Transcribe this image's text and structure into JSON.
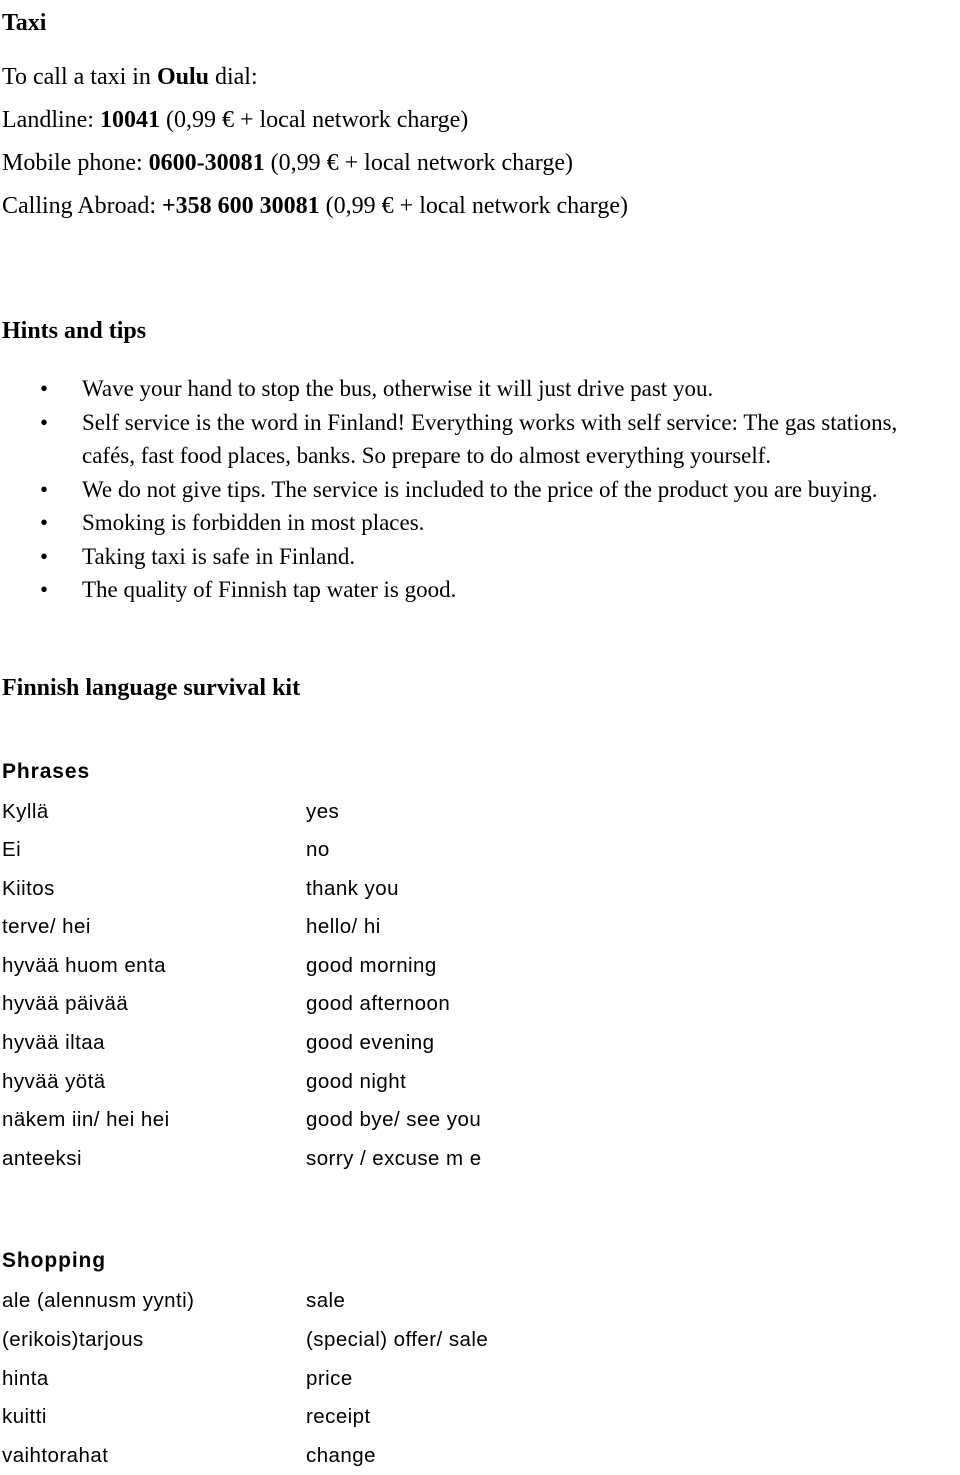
{
  "taxi": {
    "heading": "Taxi",
    "lines": [
      {
        "pre": "To call a taxi in ",
        "bold": "Oulu",
        "post": " dial:"
      },
      {
        "pre": "Landline: ",
        "bold": "10041",
        "post": " (0,99 € + local network charge)"
      },
      {
        "pre": "Mobile phone: ",
        "bold": "0600-30081",
        "post": " (0,99 € + local network charge)"
      },
      {
        "pre": "Calling Abroad: ",
        "bold": "+358 600 30081",
        "post": " (0,99 € + local network charge)"
      }
    ]
  },
  "hints": {
    "heading": "Hints and tips",
    "bullet_glyph": "•",
    "items": [
      "Wave your hand to stop the bus, otherwise it will just drive past you.",
      "Self service is the word in Finland! Everything works with self service: The gas stations, cafés, fast food places, banks. So prepare to do almost everything yourself.",
      "We do not give tips. The service is included to the price of the product you are buying.",
      "Smoking is forbidden in most places.",
      "Taking taxi is safe in Finland.",
      "The quality of Finnish tap water is good."
    ]
  },
  "kit": {
    "heading": "Finnish language survival kit",
    "phrases": {
      "heading": "Phrases",
      "rows": [
        {
          "fi": "Kyllä",
          "en": "yes"
        },
        {
          "fi": "Ei",
          "en": "no"
        },
        {
          "fi": "Kiitos",
          "en": "thank you"
        },
        {
          "fi": "terve/ hei",
          "en": "hello/ hi"
        },
        {
          "fi": "hyvää huom enta",
          "en": "good morning"
        },
        {
          "fi": "hyvää päivää",
          "en": "good afternoon"
        },
        {
          "fi": "hyvää iltaa",
          "en": "good evening"
        },
        {
          "fi": "hyvää yötä",
          "en": "good night"
        },
        {
          "fi": "näkem iin/ hei hei",
          "en": "good bye/ see you"
        },
        {
          "fi": "anteeksi",
          "en": "sorry /  excuse m e"
        }
      ]
    },
    "shopping": {
      "heading": "Shopping",
      "rows": [
        {
          "fi": "ale (alennusm yynti)",
          "en": "sale"
        },
        {
          "fi": "(erikois)tarjous",
          "en": "(special)  offer/ sale"
        },
        {
          "fi": "hinta",
          "en": "price"
        },
        {
          "fi": "kuitti",
          "en": "receipt"
        },
        {
          "fi": "vaihtorahat",
          "en": "change"
        }
      ]
    }
  }
}
